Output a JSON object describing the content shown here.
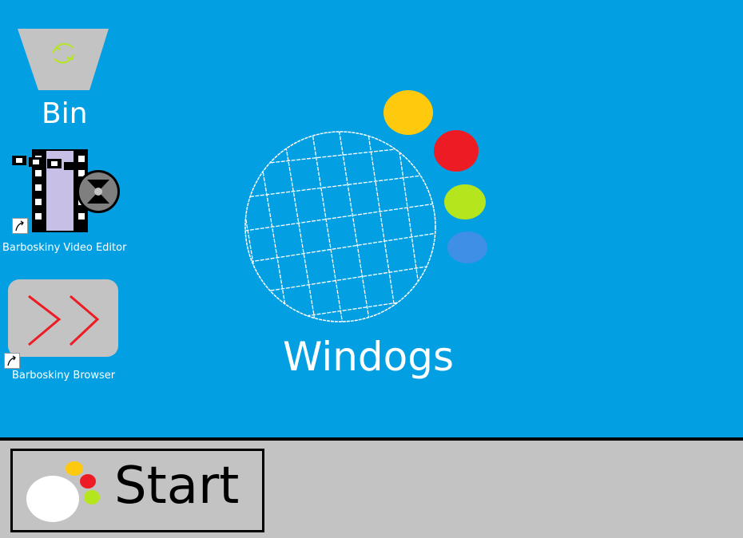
{
  "desktop": {
    "background": "#039fe3",
    "icons": [
      {
        "label": "Bin",
        "icon": "recycle-bin-icon"
      },
      {
        "label": "Barboskiny Video Editor",
        "icon": "film-reel-icon"
      },
      {
        "label": "Barboskiny Browser",
        "icon": "fast-forward-icon"
      }
    ]
  },
  "logo": {
    "text": "Windogs",
    "dot_colors": [
      "#ffc90e",
      "#ed1c24",
      "#b5e61d",
      "#3f8fe6"
    ]
  },
  "taskbar": {
    "background": "#c3c3c3",
    "start_label": "Start"
  }
}
